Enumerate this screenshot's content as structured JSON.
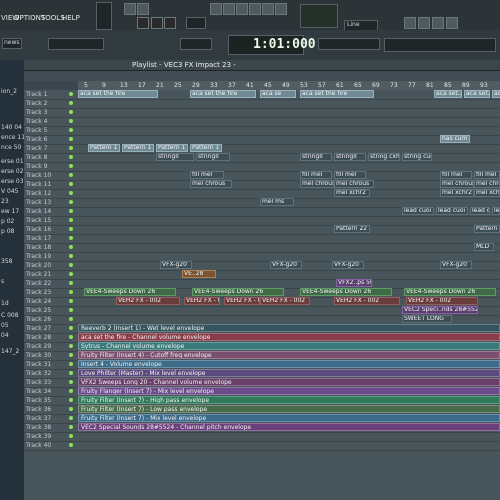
{
  "menu": [
    "VIEW",
    "OPTIONS",
    "TOOLS",
    "HELP"
  ],
  "song_position": "1:01:000",
  "pattern_field": "Line",
  "news_label": "news",
  "playlist_title": "Playlist - VEC3 FX Impact 23 -",
  "ruler_ticks": [
    "5",
    "9",
    "13",
    "17",
    "21",
    "25",
    "29",
    "33",
    "37",
    "41",
    "45",
    "49",
    "53",
    "57",
    "61",
    "65",
    "69",
    "73",
    "77",
    "81",
    "85",
    "89",
    "93"
  ],
  "browser_items": [
    "ion_2",
    "140 04",
    "ence 11",
    "nce 50",
    "erse 01",
    "erse 02",
    "erse 03",
    "V 045",
    "23",
    "ew 17",
    "p 02",
    "p 08",
    "358",
    "s",
    "1d",
    "C 008",
    "05",
    "04",
    "147_2"
  ],
  "tracks": [
    "Track 1",
    "Track 2",
    "Track 3",
    "Track 4",
    "Track 5",
    "Track 6",
    "Track 7",
    "Track 8",
    "Track 9",
    "Track 10",
    "Track 11",
    "Track 12",
    "Track 13",
    "Track 14",
    "Track 15",
    "Track 16",
    "Track 17",
    "Track 18",
    "Track 19",
    "Track 20",
    "Track 21",
    "Track 22",
    "Track 23",
    "Track 24",
    "Track 25",
    "Track 26",
    "Track 27",
    "Track 28",
    "Track 29",
    "Track 30",
    "Track 31",
    "Track 32",
    "Track 33",
    "Track 34",
    "Track 35",
    "Track 36",
    "Track 37",
    "Track 38",
    "Track 39",
    "Track 40"
  ],
  "clips_r1": [
    "aca set the fire",
    "aca set the fire",
    "aca se",
    "aca set the fire",
    "aca set..",
    "aca set..",
    "aca"
  ],
  "clips_r2": [
    "has cum"
  ],
  "clips_r6": [
    "Pattern 1",
    "Pattern 1",
    "Pattern 1",
    "Pattern 1"
  ],
  "clips_r7": [
    "stringII",
    "stringII",
    "stringII",
    "stringII",
    "string cxhr",
    "string cuoi",
    "string cuoi",
    "string cuoi"
  ],
  "clips_r9": [
    "fill mel",
    "fill mel",
    "fill mel",
    "fill mel",
    "fill mel"
  ],
  "clips_r10": [
    "mel chrous",
    "mel chrous",
    "mel chrous",
    "mel chrous",
    "mel chrous"
  ],
  "clips_r11": [
    "mel xchr2",
    "mel xchr2",
    "mel xchr2"
  ],
  "clips_r12": [
    "mel ms"
  ],
  "clips_r13": [
    "lead cuoi",
    "lead cuoi",
    "lead cuoi",
    "lead"
  ],
  "clips_r15": [
    "Pattern 22",
    "Pattern"
  ],
  "clips_r16": [
    "MLD"
  ],
  "clips_r18": [
    "VFX-g20",
    "VFX-g20",
    "VFX-g20",
    "VFX-g20"
  ],
  "clips_r19": [
    "VE..28"
  ],
  "clips_r20": [
    "VFX2..ps 50"
  ],
  "clips_r21": [
    "VEE4-Sweeps Down 26",
    "VEE4-Sweeps Down 26",
    "VEE4-Sweeps Down 26",
    "VEE4-Sweeps Down 26"
  ],
  "clips_r22": [
    "VEH2 FX - 002",
    "VEH2 FX - 002",
    "VEH2 FX - 002",
    "VEH2 FX - 002",
    "VEH2 FX - 002",
    "VEH2 FX - 002"
  ],
  "clips_r23": [
    "VEC2 Speci..nds 28#5524"
  ],
  "clips_r24": [
    "SWEET LONG"
  ],
  "envelopes": [
    {
      "label": "Reeverb 2 (Insert 1) - Wet level envelope",
      "color": "#36555e"
    },
    {
      "label": "aca set the fire - Channel volume envelope",
      "color": "#8a3c4a"
    },
    {
      "label": "Sytrus - Channel volume envelope",
      "color": "#3b7a7b"
    },
    {
      "label": "Fruity Filter (Insert 4) - Cutoff freq envelope",
      "color": "#7a4e6e"
    },
    {
      "label": "Insert 4 - Volume envelope",
      "color": "#3d6d8a"
    },
    {
      "label": "Love Philter (Master) - Mix level envelope",
      "color": "#5b4a7e"
    },
    {
      "label": "VFX2 Sweeps Long 20 - Channel volume envelope",
      "color": "#6a3f6a"
    },
    {
      "label": "Fruity Flanger (Insert 7) - Mix level envelope",
      "color": "#6b4b8a"
    },
    {
      "label": "Fruity Filter (Insert 7) - High pass envelope",
      "color": "#2e7a5a"
    },
    {
      "label": "Fruity Filter (Insert 7) - Low pass envelope",
      "color": "#4a6b4a"
    },
    {
      "label": "Fruity Filter (Insert 7) - Mix level envelope",
      "color": "#3a6b8a"
    },
    {
      "label": "VEC2 Special Sounds 28#5524 - Channel pitch envelope",
      "color": "#6a3f7a"
    }
  ],
  "accent_green": "#8fe05a"
}
